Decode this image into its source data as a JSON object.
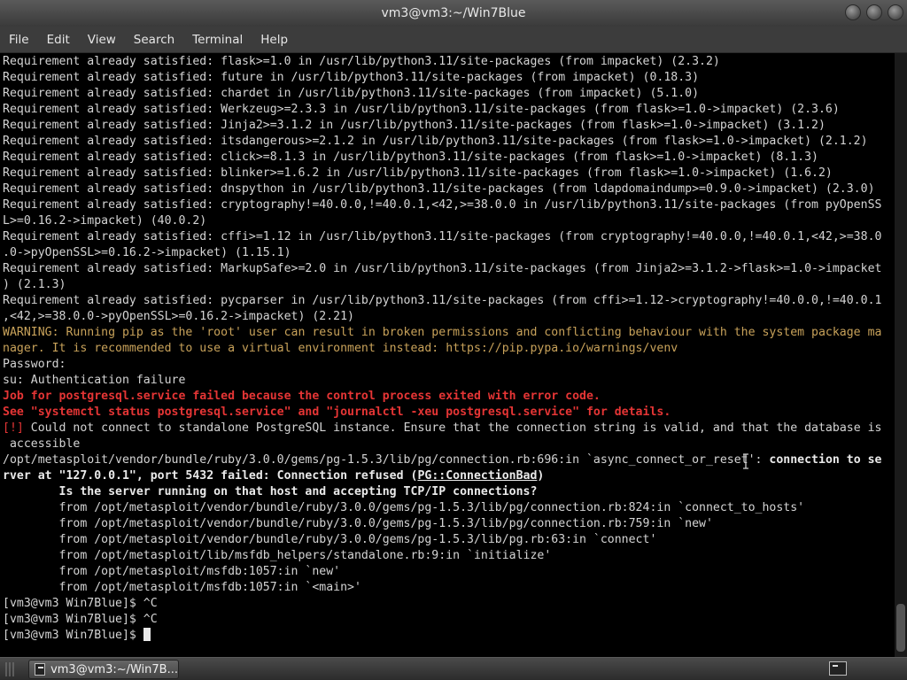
{
  "window": {
    "title": "vm3@vm3:~/Win7Blue"
  },
  "menu": [
    "File",
    "Edit",
    "View",
    "Search",
    "Terminal",
    "Help"
  ],
  "terminal": {
    "lines": [
      [
        {
          "t": "Requirement already satisfied: flask>=1.0 in /usr/lib/python3.11/site-packages (from impacket) (2.3.2)"
        }
      ],
      [
        {
          "t": "Requirement already satisfied: future in /usr/lib/python3.11/site-packages (from impacket) (0.18.3)"
        }
      ],
      [
        {
          "t": "Requirement already satisfied: chardet in /usr/lib/python3.11/site-packages (from impacket) (5.1.0)"
        }
      ],
      [
        {
          "t": "Requirement already satisfied: Werkzeug>=2.3.3 in /usr/lib/python3.11/site-packages (from flask>=1.0->impacket) (2.3.6)"
        }
      ],
      [
        {
          "t": "Requirement already satisfied: Jinja2>=3.1.2 in /usr/lib/python3.11/site-packages (from flask>=1.0->impacket) (3.1.2)"
        }
      ],
      [
        {
          "t": "Requirement already satisfied: itsdangerous>=2.1.2 in /usr/lib/python3.11/site-packages (from flask>=1.0->impacket) (2.1.2)"
        }
      ],
      [
        {
          "t": "Requirement already satisfied: click>=8.1.3 in /usr/lib/python3.11/site-packages (from flask>=1.0->impacket) (8.1.3)"
        }
      ],
      [
        {
          "t": "Requirement already satisfied: blinker>=1.6.2 in /usr/lib/python3.11/site-packages (from flask>=1.0->impacket) (1.6.2)"
        }
      ],
      [
        {
          "t": "Requirement already satisfied: dnspython in /usr/lib/python3.11/site-packages (from ldapdomaindump>=0.9.0->impacket) (2.3.0)"
        }
      ],
      [
        {
          "t": "Requirement already satisfied: cryptography!=40.0.0,!=40.0.1,<42,>=38.0.0 in /usr/lib/python3.11/site-packages (from pyOpenSS"
        }
      ],
      [
        {
          "t": "L>=0.16.2->impacket) (40.0.2)"
        }
      ],
      [
        {
          "t": "Requirement already satisfied: cffi>=1.12 in /usr/lib/python3.11/site-packages (from cryptography!=40.0.0,!=40.0.1,<42,>=38.0"
        }
      ],
      [
        {
          "t": ".0->pyOpenSSL>=0.16.2->impacket) (1.15.1)"
        }
      ],
      [
        {
          "t": "Requirement already satisfied: MarkupSafe>=2.0 in /usr/lib/python3.11/site-packages (from Jinja2>=3.1.2->flask>=1.0->impacket"
        }
      ],
      [
        {
          "t": ") (2.1.3)"
        }
      ],
      [
        {
          "t": "Requirement already satisfied: pycparser in /usr/lib/python3.11/site-packages (from cffi>=1.12->cryptography!=40.0.0,!=40.0.1"
        }
      ],
      [
        {
          "t": ",<42,>=38.0.0->pyOpenSSL>=0.16.2->impacket) (2.21)"
        }
      ],
      [
        {
          "t": "WARNING: Running pip as the 'root' user can result in broken permissions and conflicting behaviour with the system package ma",
          "c": "warn"
        }
      ],
      [
        {
          "t": "nager. It is recommended to use a virtual environment instead: https://pip.pypa.io/warnings/venv",
          "c": "warn"
        }
      ],
      [
        {
          "t": "Password:"
        }
      ],
      [
        {
          "t": "su: Authentication failure"
        }
      ],
      [
        {
          "t": "Job for postgresql.service failed because the control process exited with error code.",
          "c": "err"
        }
      ],
      [
        {
          "t": "See \"systemctl status postgresql.service\" and \"journalctl -xeu postgresql.service\" for details.",
          "c": "err"
        }
      ],
      [
        {
          "t": "[!]",
          "c": "redtag"
        },
        {
          "t": " Could not connect to standalone PostgreSQL instance. Ensure that the connection string is valid, and that the database is"
        }
      ],
      [
        {
          "t": " accessible"
        }
      ],
      [
        {
          "t": "/opt/metasploit/vendor/bundle/ruby/3.0.0/gems/pg-1.5.3/lib/pg/connection.rb:696:in `async_connect_or_reset': "
        },
        {
          "t": "connection to se",
          "c": "bold"
        }
      ],
      [
        {
          "t": "rver at \"127.0.0.1\", port 5432 failed: Connection refused (",
          "c": "bold"
        },
        {
          "t": "PG::ConnectionBad",
          "c": "bold ul"
        },
        {
          "t": ")",
          "c": "bold"
        }
      ],
      [
        {
          "t": "        Is the server running on that host and accepting TCP/IP connections?",
          "c": "bold"
        }
      ],
      [
        {
          "t": "        from /opt/metasploit/vendor/bundle/ruby/3.0.0/gems/pg-1.5.3/lib/pg/connection.rb:824:in `connect_to_hosts'"
        }
      ],
      [
        {
          "t": "        from /opt/metasploit/vendor/bundle/ruby/3.0.0/gems/pg-1.5.3/lib/pg/connection.rb:759:in `new'"
        }
      ],
      [
        {
          "t": "        from /opt/metasploit/vendor/bundle/ruby/3.0.0/gems/pg-1.5.3/lib/pg.rb:63:in `connect'"
        }
      ],
      [
        {
          "t": "        from /opt/metasploit/lib/msfdb_helpers/standalone.rb:9:in `initialize'"
        }
      ],
      [
        {
          "t": "        from /opt/metasploit/msfdb:1057:in `new'"
        }
      ],
      [
        {
          "t": "        from /opt/metasploit/msfdb:1057:in `<main>'"
        }
      ],
      [
        {
          "t": "[vm3@vm3 Win7Blue]$ ^C"
        }
      ],
      [
        {
          "t": "[vm3@vm3 Win7Blue]$ ^C"
        }
      ],
      [
        {
          "t": "[vm3@vm3 Win7Blue]$ "
        }
      ]
    ]
  },
  "taskbar": {
    "task_label": "vm3@vm3:~/Win7B..."
  }
}
